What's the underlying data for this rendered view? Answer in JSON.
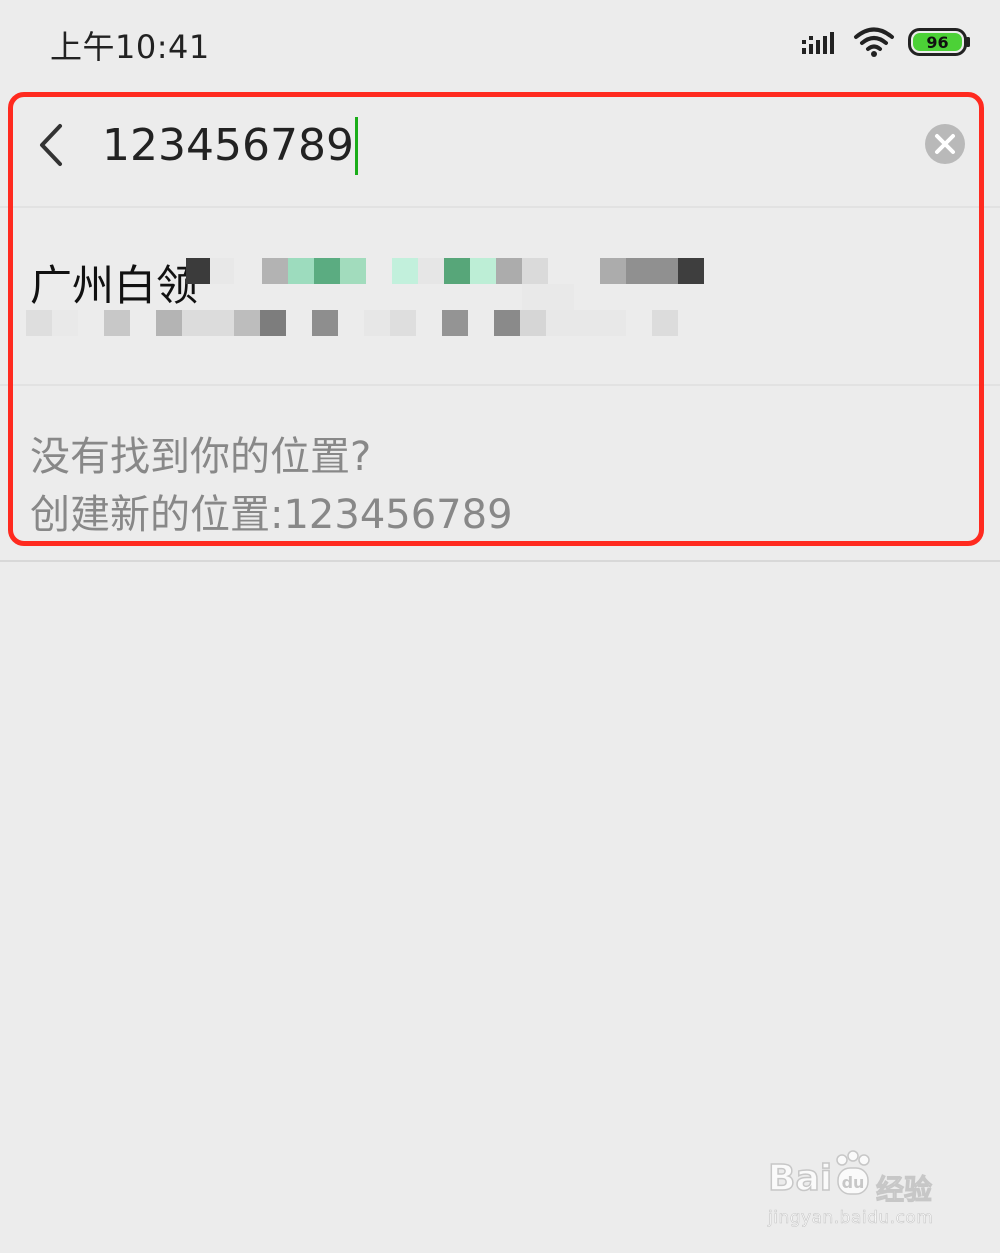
{
  "status_bar": {
    "time": "上午10:41",
    "battery_level": "96",
    "battery_color": "#4cd137",
    "signal_icon": "signal-icon",
    "wifi_icon": "wifi-icon"
  },
  "search": {
    "value": "123456789",
    "back_icon": "chevron-left-icon",
    "clear_icon": "close-circle-icon",
    "caret_color": "#1aad19"
  },
  "results": [
    {
      "title": "广州白领"
    }
  ],
  "create_location": {
    "hint": "没有找到你的位置?",
    "label": "创建新的位置:123456789"
  },
  "highlight_color": "#ff2a1f",
  "watermark": {
    "brand": "Bai",
    "brand_suffix": "经验",
    "url": "jingyan.baidu.com"
  }
}
